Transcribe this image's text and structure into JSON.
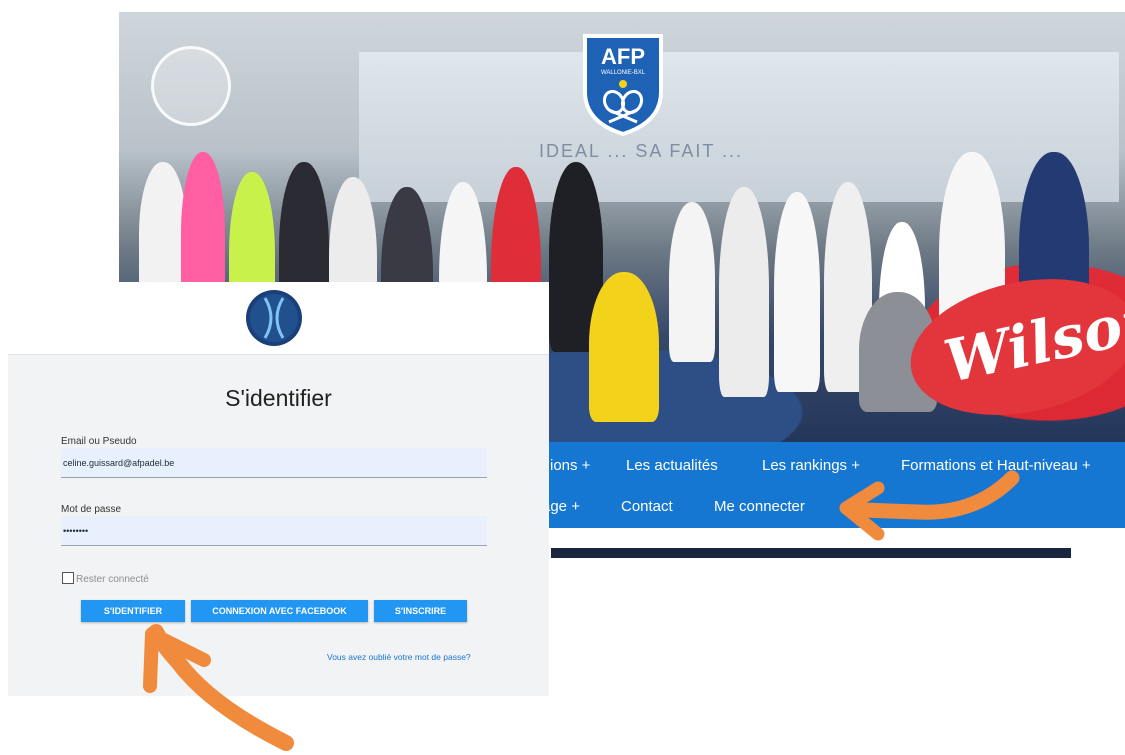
{
  "website": {
    "logo_text": "AFP",
    "logo_subtext": "WALLONIE-BXL",
    "slogan": "IDEAL ... SA FAIT ...",
    "banner_text": "Wilson",
    "nav": {
      "row1": [
        "ions +",
        "Les actualités",
        "Les rankings +",
        "Formations et Haut-niveau +"
      ],
      "row2": [
        "age +",
        "Contact",
        "Me connecter"
      ]
    }
  },
  "login": {
    "title": "S'identifier",
    "email_label": "Email ou Pseudo",
    "email_value": "celine.guissard@afpadel.be",
    "password_label": "Mot de passe",
    "password_value": "••••••••",
    "remember_label": "Rester connecté",
    "buttons": {
      "signin": "S'IDENTIFIER",
      "facebook": "CONNEXION AVEC FACEBOOK",
      "register": "S'INSCRIRE"
    },
    "forgot": "Vous avez oublié votre mot de passe?"
  },
  "colors": {
    "nav_blue": "#1677d2",
    "button_blue": "#2196f3",
    "arrow_orange": "#f08a3c",
    "logo_navy": "#1b3f79"
  }
}
